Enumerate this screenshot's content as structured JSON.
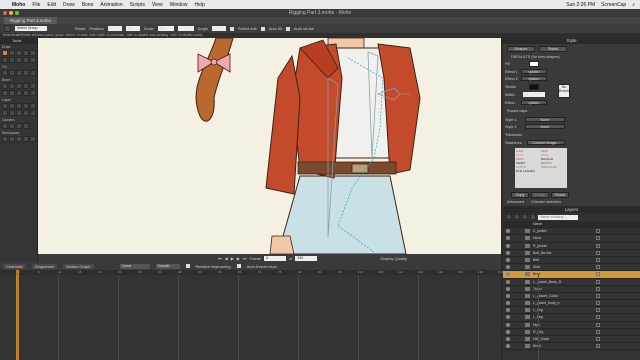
{
  "menubar": {
    "app": "Moho",
    "items": [
      "File",
      "Edit",
      "Draw",
      "Bone",
      "Animation",
      "Scripts",
      "View",
      "Window",
      "Help"
    ],
    "clock": "Sun 2:26 PM",
    "user": "ScreenCap"
  },
  "window": {
    "title": "Rigging Part 3.moho - Moho",
    "tab": "Rigging Part 3.moho"
  },
  "options_bar": {
    "group_select": "Select Group",
    "reset": "Reset",
    "position_label": "Position",
    "pos_x": "…",
    "pos_y": "…",
    "scale_label": "Scale",
    "scale_val": "…",
    "angle_label": "Angle",
    "select_edit": "Select edit",
    "auto_fill": "Auto fill",
    "auto stroke": "Auto stroke"
  },
  "hint": "Move/Scale/Rotate selected points (press <letter> to weld, hold <shift> to constrain, <alt> to disable auto-welding, <ctrl> to disable scale)",
  "tools": {
    "title": "Tools",
    "groups": [
      "Draw",
      "Fill",
      "Bone",
      "Layer",
      "Camera",
      "Workspace"
    ]
  },
  "canvas_controls": {
    "frame_label": "Frame",
    "frame": "0",
    "of": "of",
    "end": "240",
    "quality": "Display Quality"
  },
  "style": {
    "title": "Style",
    "shapes_btn": "Shapes",
    "styles_btn": "Styles",
    "defaults": "DEFAULTS (for new shapes)",
    "fill": "Fill",
    "stroke": "Stroke",
    "width": "Width",
    "effect1": "Effect 1",
    "effect2": "Effect 2",
    "effect": "Effect",
    "plain": "<plain>",
    "no_brush": "No Brush",
    "round_caps": "Round caps",
    "style1": "Style 1",
    "style2": "Style 2",
    "thickness": "Thickness",
    "swatches": "Swatches",
    "custom_image": "Custom image...",
    "none": "None",
    "swatch_labels": [
      "HAIR",
      "SKIN",
      "VEST",
      "SHIRT",
      "PANTS",
      "EYE LASHES",
      "LIPS",
      "BOW",
      "BUCKLE",
      "BOOTS",
      "FRECKLES"
    ],
    "copy": "Copy",
    "paste": "Paste",
    "reset": "Reset",
    "advanced": "Advanced",
    "checker": "Checker selection",
    "colors": {
      "accent": "#d98b2b",
      "swatch_bg": "#d9d9d9"
    }
  },
  "layers": {
    "title": "Layers",
    "name_header": "Name",
    "search_placeholder": "Name contains...",
    "rows": [
      "S_jacket",
      "Neck",
      "R_jacket",
      "Belt_Buckle",
      "Belt",
      "Skirt",
      "Bust",
      "L_Jacket_Body_B",
      "Torso",
      "L_Jacket_Collar",
      "L_jacket_body_b",
      "L_Leg",
      "L_Leg",
      "Hips",
      "R_Leg",
      "Hair_Back",
      "Braid"
    ],
    "selected_index": 6
  },
  "timeline": {
    "tabs": [
      "Channels",
      "Sequencer",
      "Motion Graph"
    ],
    "interp": "Linear",
    "smooth": "Smooth",
    "relative": "Relative keyframing",
    "auto_freeze": "Auto-freeze keys",
    "ticks": [
      "0",
      "6",
      "12",
      "18",
      "24",
      "30",
      "36",
      "42",
      "48",
      "54",
      "60",
      "66",
      "72",
      "78",
      "84",
      "90",
      "96",
      "102",
      "108",
      "114",
      "120",
      "126",
      "132",
      "138",
      "144"
    ]
  }
}
